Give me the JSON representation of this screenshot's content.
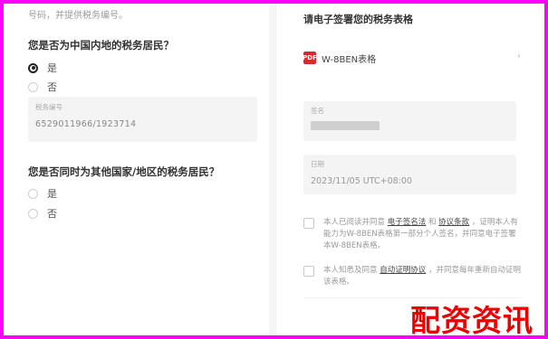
{
  "left": {
    "hint": "号码，并提供税务编号。",
    "q1": "您是否为中国内地的税务居民？",
    "q1_options": [
      {
        "label": "是",
        "checked": true
      },
      {
        "label": "否",
        "checked": false
      }
    ],
    "tax_id_label": "税务编号",
    "tax_id_value": "6529011966/1923714",
    "q2": "您是否同时为其他国家/地区的税务居民？",
    "q2_options": [
      {
        "label": "是",
        "checked": false
      },
      {
        "label": "否",
        "checked": false
      }
    ]
  },
  "right": {
    "title": "请电子签署您的税务表格",
    "form_icon_text": "PDF",
    "form_name": "W-8BEN表格",
    "chevron": "›",
    "signature_label": "签名",
    "date_label": "日期",
    "date_value": "2023/11/05 UTC+08:00",
    "check1": {
      "prefix": "本人已阅读并同意",
      "link1": "电子签名法",
      "mid": "和",
      "link2": "协议条款",
      "suffix": "，证明本人有能力为W-8BEN表格第一部分个人签名，并同意电子签署本W-8BEN表格。"
    },
    "check2": {
      "prefix": "本人知悉及同意",
      "link": "自动证明协议",
      "suffix": "，并同意每年重新自动证明该表格。"
    }
  },
  "watermark": "配资资讯",
  "colors": {
    "border": "#ff00ff",
    "watermark": "#ee0000",
    "pdf_icon": "#d62b2b"
  }
}
